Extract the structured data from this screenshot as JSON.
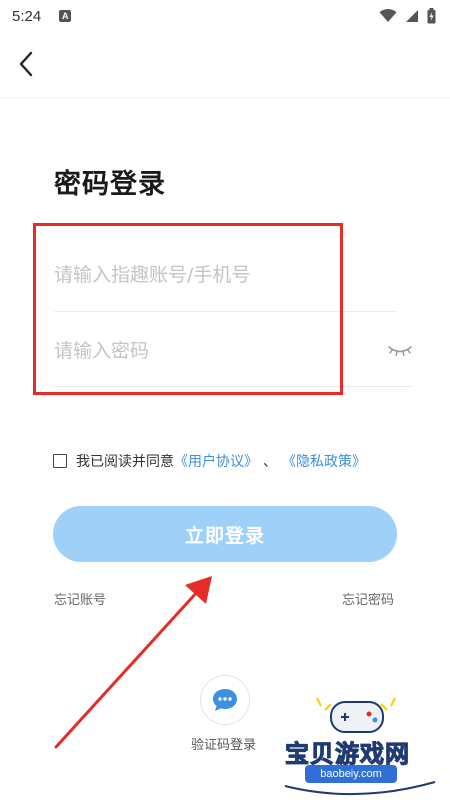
{
  "status_bar": {
    "time": "5:24",
    "notification_badge": "A",
    "icons": [
      "wifi-icon",
      "cell-signal-icon",
      "battery-icon"
    ]
  },
  "header": {
    "back_icon": "chevron-left-icon"
  },
  "page": {
    "title": "密码登录"
  },
  "form": {
    "account_placeholder": "请输入指趣账号/手机号",
    "account_value": "",
    "password_placeholder": "请输入密码",
    "password_value": "",
    "password_toggle_icon": "eye-closed-icon",
    "agreement": {
      "checked": false,
      "prefix": "我已阅读并同意",
      "user_agreement": "《用户协议》",
      "separator": "、",
      "privacy_policy": "《隐私政策》"
    },
    "login_button": "立即登录",
    "forgot_account": "忘记账号",
    "forgot_password": "忘记密码"
  },
  "alt_login": {
    "icon": "chat-bubble-icon",
    "label": "验证码登录"
  },
  "watermark": {
    "title": "宝贝游戏网",
    "url": "baobeiy.com"
  },
  "colors": {
    "accent": "#3d8fe0",
    "button_disabled": "#9fd0f7",
    "annotation_red": "#e52d27"
  }
}
